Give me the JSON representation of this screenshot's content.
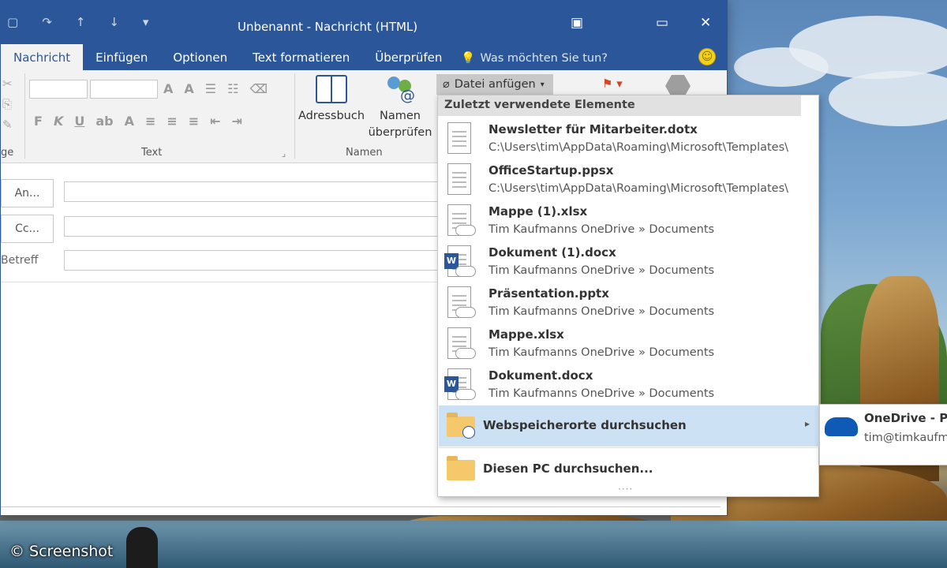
{
  "window": {
    "title": "Unbenannt - Nachricht (HTML)",
    "controls": [
      "▣",
      "▭",
      "✕"
    ]
  },
  "tabs": [
    {
      "label": "Nachricht",
      "active": true
    },
    {
      "label": "Einfügen"
    },
    {
      "label": "Optionen"
    },
    {
      "label": "Text formatieren"
    },
    {
      "label": "Überprüfen"
    }
  ],
  "tell_me": "Was möchten Sie tun?",
  "ribbon": {
    "group_text_label": "Text",
    "group_names_label": "Namen",
    "group_left_label": "ge",
    "address_book": "Adressbuch",
    "check_names_line1": "Namen",
    "check_names_line2": "überprüfen",
    "attach_file": "Datei anfügen"
  },
  "form": {
    "to_button": "An...",
    "cc_button": "Cc...",
    "subject_label": "Betreff"
  },
  "menu": {
    "header": "Zuletzt verwendete Elemente",
    "items": [
      {
        "name": "Newsletter für Mitarbeiter.dotx",
        "path": "C:\\Users\\tim\\AppData\\Roaming\\Microsoft\\Templates\\",
        "icon": "document-icon"
      },
      {
        "name": "OfficeStartup.ppsx",
        "path": "C:\\Users\\tim\\AppData\\Roaming\\Microsoft\\Templates\\",
        "icon": "document-icon"
      },
      {
        "name": "Mappe (1).xlsx",
        "path": "Tim Kaufmanns OneDrive » Documents",
        "icon": "cloud-document-icon"
      },
      {
        "name": "Dokument (1).docx",
        "path": "Tim Kaufmanns OneDrive » Documents",
        "icon": "word-cloud-document-icon"
      },
      {
        "name": "Präsentation.pptx",
        "path": "Tim Kaufmanns OneDrive » Documents",
        "icon": "cloud-document-icon"
      },
      {
        "name": "Mappe.xlsx",
        "path": "Tim Kaufmanns OneDrive » Documents",
        "icon": "cloud-document-icon"
      },
      {
        "name": "Dokument.docx",
        "path": "Tim Kaufmanns OneDrive » Documents",
        "icon": "word-cloud-document-icon"
      }
    ],
    "browse_web": "Webspeicherorte durchsuchen",
    "browse_pc": "Diesen PC durchsuchen..."
  },
  "submenu": {
    "title": "OneDrive - Pe",
    "email": "tim@timkaufm"
  },
  "watermark": "© Screenshot"
}
